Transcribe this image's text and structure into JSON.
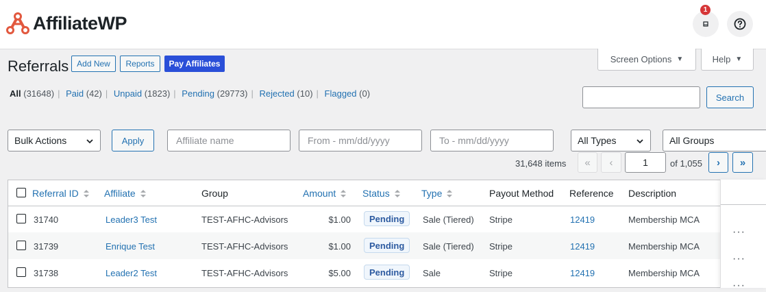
{
  "brand": {
    "name": "AffiliateWP",
    "accent": "#e2583e"
  },
  "header": {
    "notification_count": "1"
  },
  "screen_options_label": "Screen Options",
  "help_label": "Help",
  "page": {
    "title": "Referrals",
    "add_new": "Add New",
    "reports": "Reports",
    "pay_affiliates": "Pay Affiliates"
  },
  "filters": [
    {
      "label": "All",
      "count": "(31648)"
    },
    {
      "label": "Paid",
      "count": "(42)"
    },
    {
      "label": "Unpaid",
      "count": "(1823)"
    },
    {
      "label": "Pending",
      "count": "(29773)"
    },
    {
      "label": "Rejected",
      "count": "(10)"
    },
    {
      "label": "Flagged",
      "count": "(0)"
    }
  ],
  "search_button": "Search",
  "toolbar": {
    "bulk_actions": "Bulk Actions",
    "apply": "Apply",
    "affiliate_placeholder": "Affiliate name",
    "from_placeholder": "From - mm/dd/yyyy",
    "to_placeholder": "To - mm/dd/yyyy",
    "types": "All Types",
    "groups": "All Groups"
  },
  "pagination": {
    "items": "31,648 items",
    "first": "«",
    "prev": "‹",
    "current_page": "1",
    "of_total": "of 1,055",
    "next": "›",
    "last": "»"
  },
  "table": {
    "headers": {
      "referral_id": "Referral ID",
      "affiliate": "Affiliate",
      "group": "Group",
      "amount": "Amount",
      "status": "Status",
      "type": "Type",
      "payout_method": "Payout Method",
      "reference": "Reference",
      "description": "Description"
    },
    "rows": [
      {
        "id": "31740",
        "affiliate": "Leader3 Test",
        "group": "TEST-AFHC-Advisors",
        "amount": "$1.00",
        "status": "Pending",
        "type": "Sale (Tiered)",
        "payout": "Stripe",
        "reference": "12419",
        "description": "Membership MCA"
      },
      {
        "id": "31739",
        "affiliate": "Enrique Test",
        "group": "TEST-AFHC-Advisors",
        "amount": "$1.00",
        "status": "Pending",
        "type": "Sale (Tiered)",
        "payout": "Stripe",
        "reference": "12419",
        "description": "Membership MCA"
      },
      {
        "id": "31738",
        "affiliate": "Leader2 Test",
        "group": "TEST-AFHC-Advisors",
        "amount": "$5.00",
        "status": "Pending",
        "type": "Sale",
        "payout": "Stripe",
        "reference": "12419",
        "description": "Membership MCA"
      }
    ],
    "row_actions": "···"
  }
}
